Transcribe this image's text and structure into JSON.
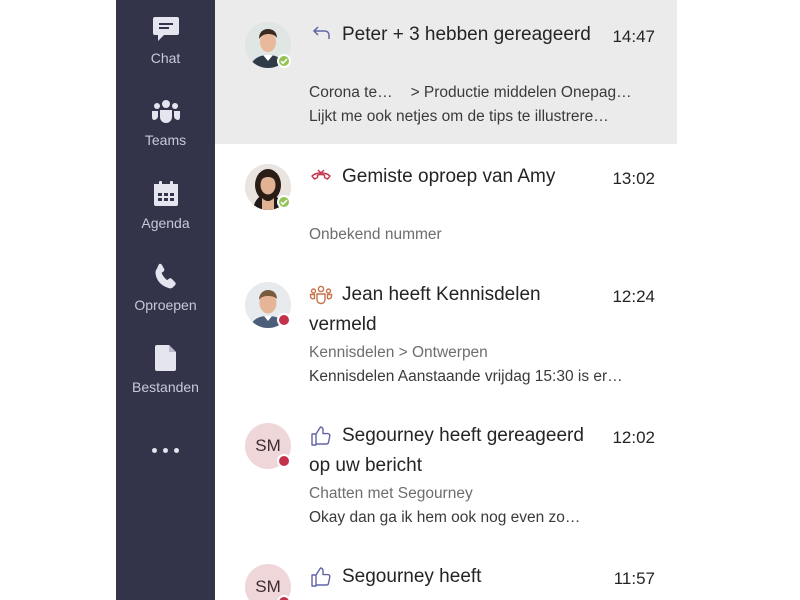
{
  "nav": {
    "items": [
      {
        "label": "Chat",
        "icon": "chat-icon"
      },
      {
        "label": "Teams",
        "icon": "teams-icon"
      },
      {
        "label": "Agenda",
        "icon": "calendar-icon"
      },
      {
        "label": "Oproepen",
        "icon": "phone-icon"
      },
      {
        "label": "Bestanden",
        "icon": "file-icon"
      }
    ],
    "more_icon": "more-icon"
  },
  "feed": {
    "items": [
      {
        "title": "Peter + 3 hebben gereageerd",
        "time": "14:47",
        "line1_left": "Corona te…",
        "line1_right": "> Productie middelen Onepag…",
        "line2": "Lijkt me ook netjes om de tips te illustrere…",
        "type_icon": "reply-icon",
        "avatar": "peter-photo",
        "presence": "available",
        "selected": true
      },
      {
        "title": "Gemiste oproep van Amy",
        "time": "13:02",
        "line1": "Onbekend nummer",
        "type_icon": "missed-call-icon",
        "avatar": "amy-photo",
        "presence": "available"
      },
      {
        "title": "Jean heeft Kennisdelen vermeld",
        "time": "12:24",
        "line1": "Kennisdelen > Ontwerpen",
        "line2": "Kennisdelen Aanstaande vrijdag 15:30 is er…",
        "type_icon": "team-mention-icon",
        "avatar": "jean-photo",
        "presence": "busy"
      },
      {
        "title": "Segourney heeft gereageerd op uw bericht",
        "time": "12:02",
        "line1": "Chatten met Segourney",
        "line2": "Okay dan ga ik hem ook nog even zo…",
        "type_icon": "like-icon",
        "avatar_initials": "SM",
        "presence": "busy"
      },
      {
        "title": "Segourney heeft",
        "time": "11:57",
        "type_icon": "like-icon",
        "avatar_initials": "SM",
        "presence": "busy"
      }
    ]
  },
  "colors": {
    "rail": "#33344a",
    "selected_row": "#ebebeb",
    "presence_available": "#92c353",
    "presence_busy": "#c4314b",
    "accent": "#6264a7",
    "missed_call": "#c4314b"
  }
}
